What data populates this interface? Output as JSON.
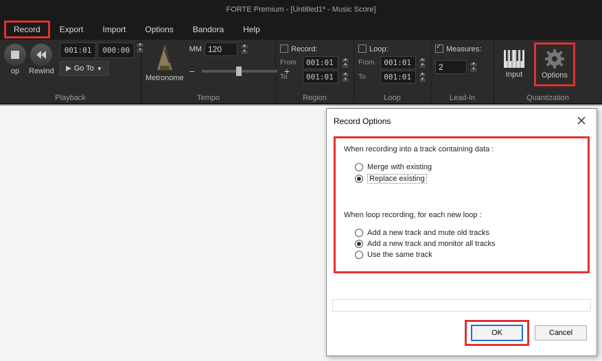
{
  "title": "FORTE Premium - [Untitled1* - Music Score]",
  "menu": {
    "record": "Record",
    "export": "Export",
    "import": "Import",
    "options": "Options",
    "bandora": "Bandora",
    "help": "Help"
  },
  "playback": {
    "group": "Playback",
    "stop": "op",
    "rewind": "Rewind",
    "time1": "001:01",
    "time2": "000:00",
    "goto": "Go To"
  },
  "tempo": {
    "group": "Tempo",
    "metronome": "Metronome",
    "mm": "MM",
    "value": "120",
    "minus": "−",
    "plus": "+"
  },
  "region": {
    "group": "Region",
    "record": "Record:",
    "from_lbl": "From",
    "to_lbl": "To",
    "from": "001:01",
    "to": "001:01"
  },
  "loop": {
    "group": "Loop",
    "loop": "Loop:",
    "from_lbl": "From",
    "to_lbl": "To",
    "from": "001:01",
    "to": "001:01"
  },
  "leadin": {
    "group": "Lead-In",
    "measures": "Measures:",
    "value": "2"
  },
  "quant": {
    "group": "Quantization",
    "input": "Input",
    "options": "Options"
  },
  "dialog": {
    "title": "Record Options",
    "group1_label": "When recording into a track containing data :",
    "opt_merge": "Merge with existing",
    "opt_replace": "Replace existing",
    "group2_label": "When loop recording, for each new loop :",
    "opt_add_mute": "Add a new track and mute old tracks",
    "opt_add_monitor": "Add a new track and monitor all tracks",
    "opt_same": "Use the same track",
    "ok": "OK",
    "cancel": "Cancel"
  }
}
